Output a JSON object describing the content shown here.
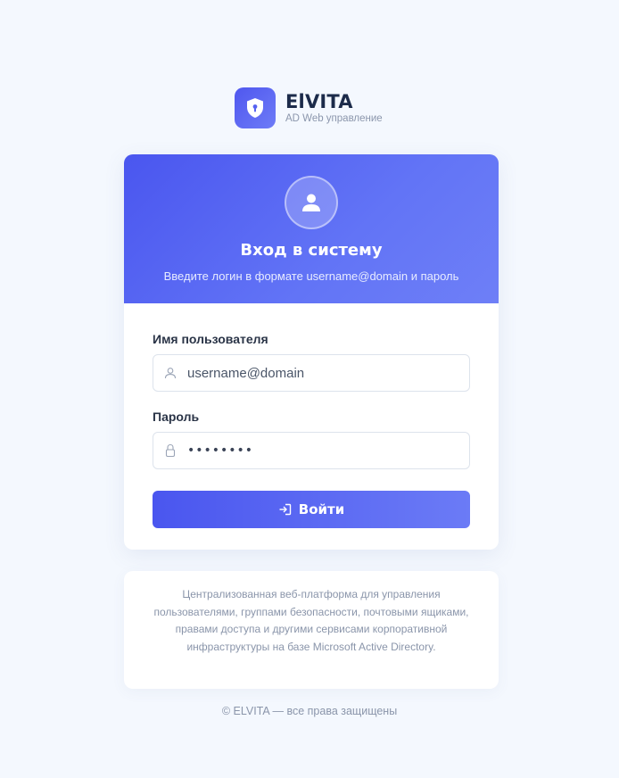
{
  "brand": {
    "name": "ElVITA",
    "subtitle": "AD Web управление",
    "logo_icon": "shield-lock-icon",
    "accent_color": "#4f57ef"
  },
  "login": {
    "avatar_icon": "user-icon",
    "title": "Вход в систему",
    "subtitle": "Введите логин в формате username@domain и пароль",
    "username_label": "Имя пользователя",
    "username_placeholder": "username@domain",
    "username_icon": "user-outline-icon",
    "password_label": "Пароль",
    "password_value": "••••••••",
    "password_icon": "lock-icon",
    "submit_label": "Войти",
    "submit_icon": "sign-in-icon"
  },
  "info": {
    "text": "Централизованная веб-платформа для управления пользователями, группами безопасности, почтовыми ящиками, правами доступа и другими сервисами корпоративной инфраструктуры на базе Microsoft Active Directory."
  },
  "footer": {
    "text": "© ELVITA — все права защищены"
  }
}
